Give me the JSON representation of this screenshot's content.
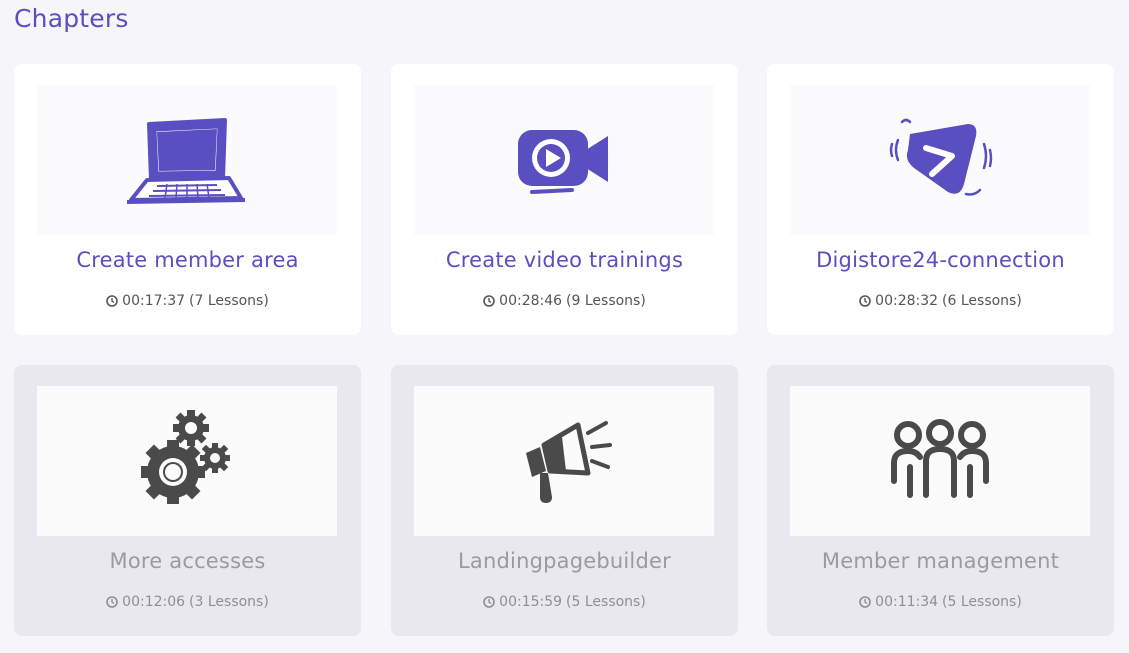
{
  "page": {
    "title": "Chapters"
  },
  "cards": [
    {
      "title": "Create member area",
      "duration": "00:17:37",
      "lessons": "(7 Lessons)",
      "icon": "laptop-icon",
      "state": "active"
    },
    {
      "title": "Create video trainings",
      "duration": "00:28:46",
      "lessons": "(9 Lessons)",
      "icon": "video-camera-icon",
      "state": "active"
    },
    {
      "title": "Digistore24-connection",
      "duration": "00:28:32",
      "lessons": "(6 Lessons)",
      "icon": "digistore-logo-icon",
      "state": "active"
    },
    {
      "title": "More accesses",
      "duration": "00:12:06",
      "lessons": "(3 Lessons)",
      "icon": "gears-icon",
      "state": "locked"
    },
    {
      "title": "Landingpagebuilder",
      "duration": "00:15:59",
      "lessons": "(5 Lessons)",
      "icon": "megaphone-icon",
      "state": "locked"
    },
    {
      "title": "Member management",
      "duration": "00:11:34",
      "lessons": "(5 Lessons)",
      "icon": "users-group-icon",
      "state": "locked"
    }
  ],
  "colors": {
    "accent": "#5a4fc0",
    "locked_icon": "#4a4a4a",
    "background": "#f5f5fa"
  }
}
